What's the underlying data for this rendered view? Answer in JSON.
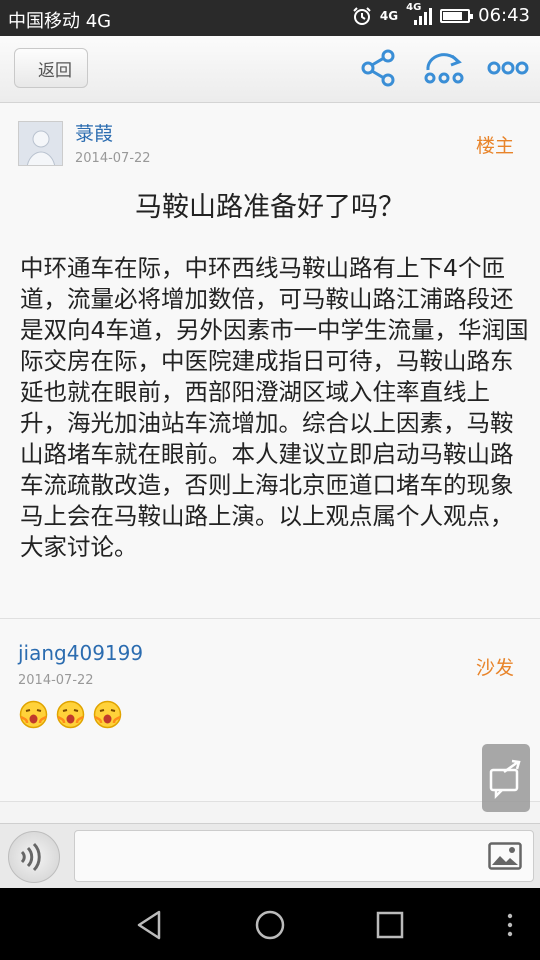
{
  "status_bar": {
    "carrier": "中国移动 4G",
    "net_label_1": "4G",
    "net_label_2": "4G",
    "time": "06:43"
  },
  "toolbar": {
    "back_label": "返回"
  },
  "post": {
    "author": "菉葭",
    "date": "2014-07-22",
    "floor_label": "楼主",
    "title": "马鞍山路准备好了吗？",
    "body": "中环通车在际，中环西线马鞍山路有上下4个匝道，流量必将增加数倍，可马鞍山路江浦路段还是双向4车道，另外因素市一中学生流量，华润国际交房在际，中医院建成指日可待，马鞍山路东延也就在眼前，西部阳澄湖区域入住率直线上升，海光加油站车流增加。综合以上因素，马鞍山路堵车就在眼前。本人建议立即启动马鞍山路车流疏散改造，否则上海北京匝道口堵车的现象马上会在马鞍山路上演。以上观点属个人观点，大家讨论。"
  },
  "reply": {
    "author": "jiang409199",
    "date": "2014-07-22",
    "floor_label": "沙发",
    "emoji_count": 3
  },
  "input_bar": {
    "placeholder": ""
  },
  "colors": {
    "link": "#2b6cb0",
    "accent": "#e8842a",
    "status_bar": "#2a2a2a",
    "nav_bar": "#000000"
  }
}
